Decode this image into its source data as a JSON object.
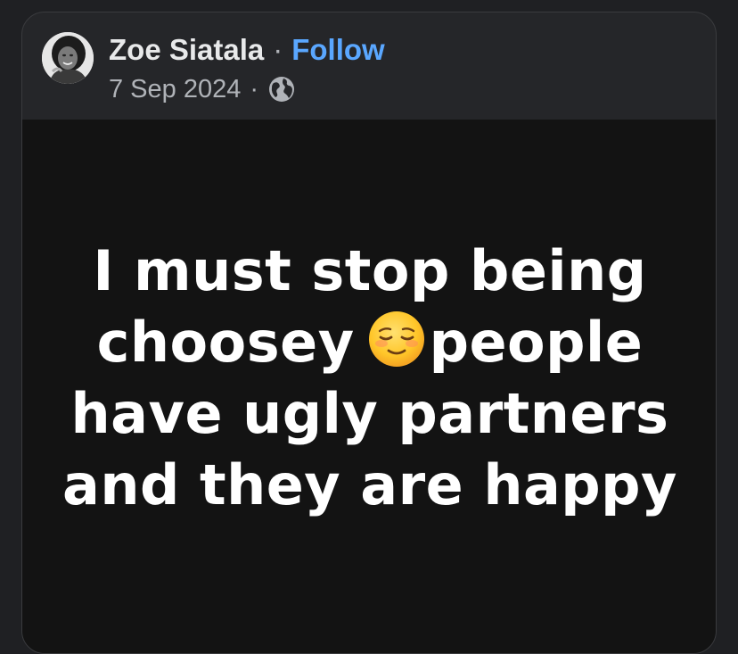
{
  "post": {
    "author": "Zoe Siatala",
    "separator": "·",
    "follow_label": "Follow",
    "date": "7 Sep 2024",
    "meta_separator": "·",
    "privacy_icon": "globe-icon",
    "avatar_icon": "profile-photo",
    "text_lines": [
      "I must stop being",
      "choosey",
      "people",
      "have ugly partners",
      "and they are happy"
    ],
    "emoji": "relieved-face-emoji"
  },
  "colors": {
    "page_background": "#1f2023",
    "card_background": "#252629",
    "post_background": "#131313",
    "follow": "#5aa7ff",
    "secondary_text": "#b0b3b8",
    "post_text": "#ffffff"
  }
}
